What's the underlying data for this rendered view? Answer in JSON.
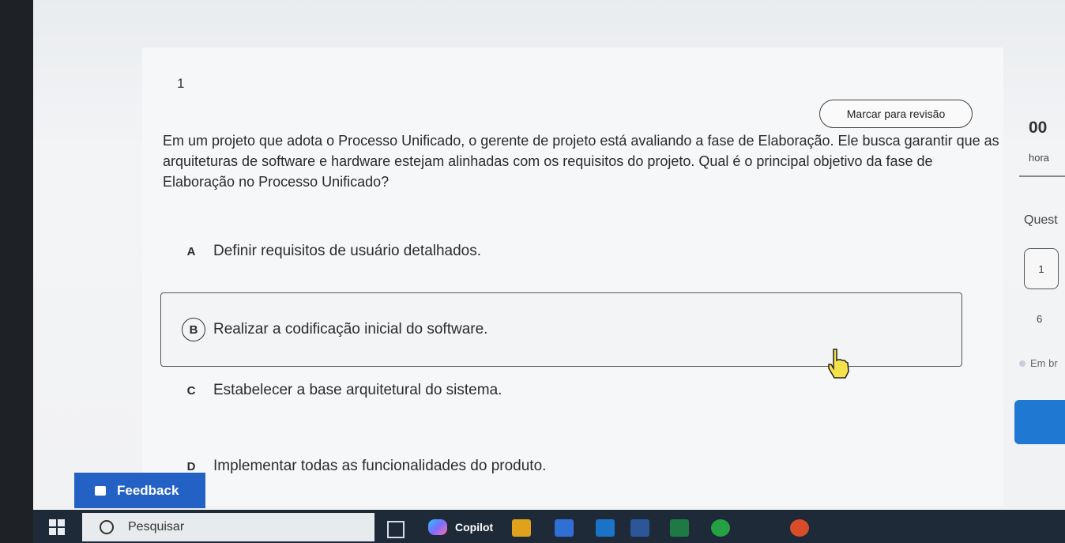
{
  "question": {
    "number": "1",
    "review_button": "Marcar para revisão",
    "stem": "Em um projeto que adota o Processo Unificado, o gerente de projeto está avaliando a fase de Elaboração. Ele busca garantir que as arquiteturas de software e hardware estejam alinhadas com os requisitos do projeto. Qual é o principal objetivo da fase de Elaboração no Processo Unificado?",
    "options": [
      {
        "letter": "A",
        "text": "Definir requisitos de usuário detalhados."
      },
      {
        "letter": "B",
        "text": "Realizar a codificação inicial do software."
      },
      {
        "letter": "C",
        "text": "Estabelecer a base arquitetural do sistema."
      },
      {
        "letter": "D",
        "text": "Implementar todas as funcionalidades do produto."
      }
    ],
    "selected": "B"
  },
  "sidebar": {
    "timer_value": "00",
    "timer_unit": "hora",
    "questions_label": "Quest",
    "current_question": "1",
    "total_label": "6",
    "status_label": "Em br"
  },
  "feedback": {
    "label": "Feedback"
  },
  "taskbar": {
    "search_placeholder": "Pesquisar",
    "copilot_label": "Copilot"
  },
  "colors": {
    "accent_blue": "#1f78d1",
    "feedback_blue": "#2362c4",
    "taskbar": "#1f2a38"
  }
}
